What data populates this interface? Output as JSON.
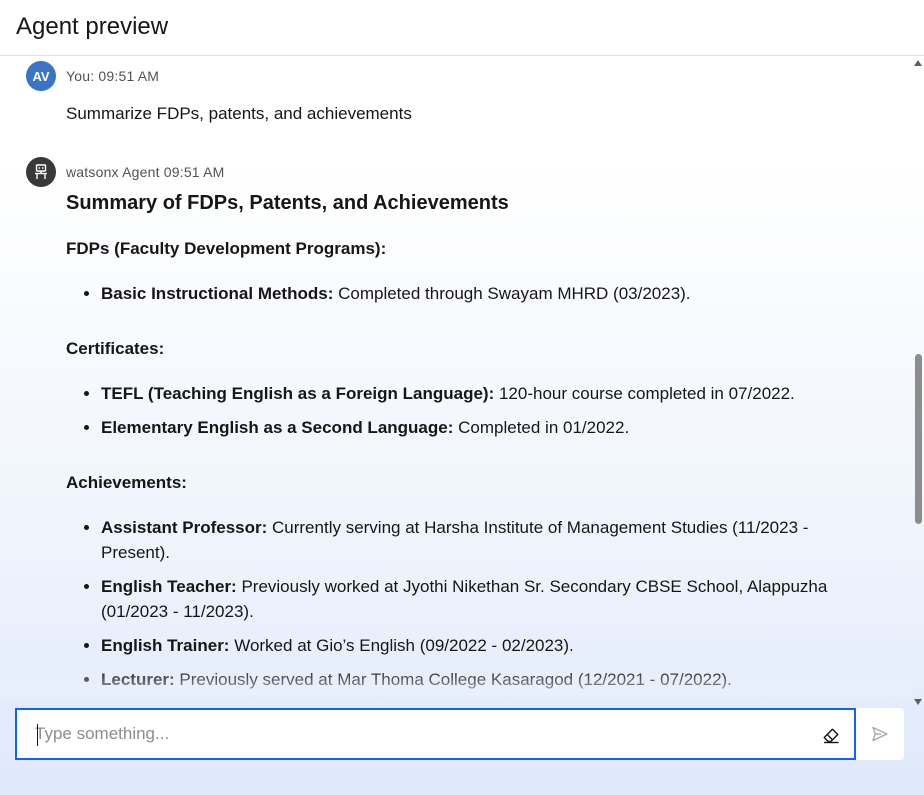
{
  "header": {
    "title": "Agent preview"
  },
  "messages": {
    "user": {
      "avatar_initials": "AV",
      "meta": "You: 09:51 AM",
      "text": "Summarize FDPs, patents, and achievements"
    },
    "agent": {
      "meta": "watsonx Agent 09:51 AM",
      "avatar_icon": "robot-icon",
      "heading": "Summary of FDPs, Patents, and Achievements",
      "sections": [
        {
          "title": "FDPs (Faculty Development Programs):",
          "items": [
            {
              "label": "Basic Instructional Methods:",
              "text": " Completed through Swayam MHRD (03/2023)."
            }
          ]
        },
        {
          "title": "Certificates:",
          "items": [
            {
              "label": "TEFL (Teaching English as a Foreign Language):",
              "text": " 120-hour course completed in 07/2022."
            },
            {
              "label": "Elementary English as a Second Language:",
              "text": " Completed in 01/2022."
            }
          ]
        },
        {
          "title": "Achievements:",
          "items": [
            {
              "label": "Assistant Professor:",
              "text": " Currently serving at Harsha Institute of Management Studies (11/2023 - Present)."
            },
            {
              "label": "English Teacher:",
              "text": " Previously worked at Jyothi Nikethan Sr. Secondary CBSE School, Alappuzha (01/2023 - 11/2023)."
            },
            {
              "label": "English Trainer:",
              "text": " Worked at Gio’s English (09/2022 - 02/2023)."
            },
            {
              "label": "Lecturer:",
              "text": " Previously served at Mar Thoma College Kasaragod (12/2021 - 07/2022)."
            }
          ]
        }
      ]
    }
  },
  "composer": {
    "placeholder": "Type something...",
    "value": "",
    "clear_icon": "eraser-icon",
    "send_icon": "send-icon"
  },
  "colors": {
    "accent": "#0f62fe",
    "user_avatar": "#3a74c6",
    "agent_avatar": "#393939"
  }
}
